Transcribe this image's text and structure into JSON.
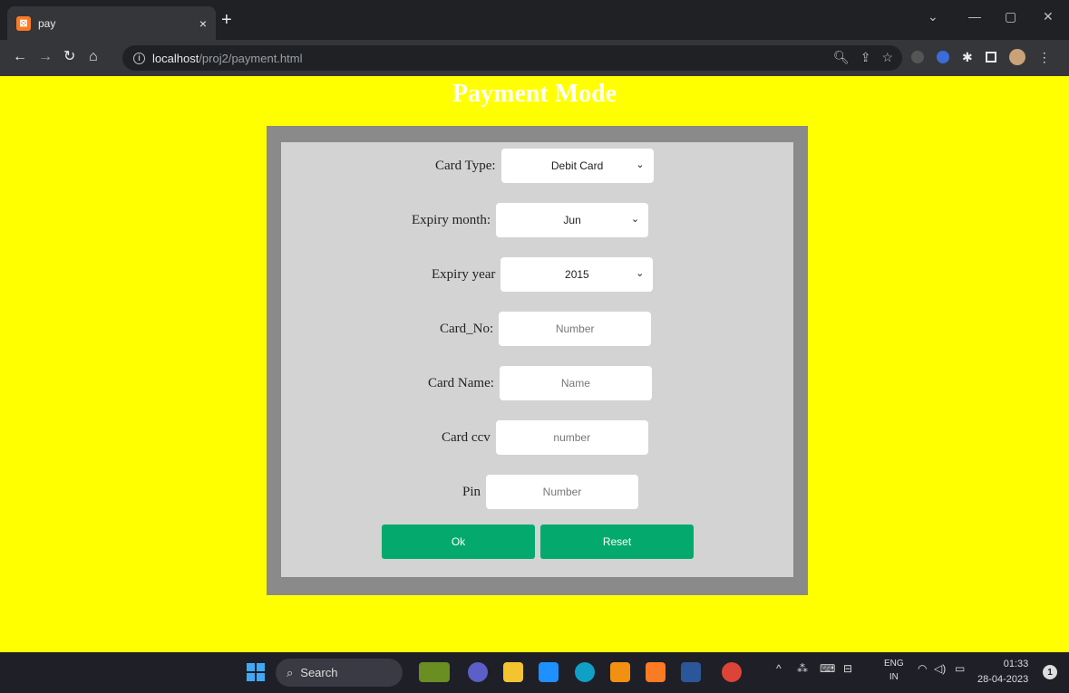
{
  "browser": {
    "tab_title": "pay",
    "tab_close": "×",
    "new_tab": "+",
    "url_host": "localhost",
    "url_path": "/proj2/payment.html"
  },
  "page": {
    "title": "Payment Mode",
    "form": {
      "card_type": {
        "label": "Card Type:",
        "value": "Debit Card"
      },
      "expiry_month": {
        "label": "Expiry month:",
        "value": "Jun"
      },
      "expiry_year": {
        "label": "Expiry year",
        "value": "2015"
      },
      "card_no": {
        "label": "Card_No:",
        "placeholder": "Number"
      },
      "card_name": {
        "label": "Card Name:",
        "placeholder": "Name"
      },
      "card_ccv": {
        "label": "Card ccv",
        "placeholder": "number"
      },
      "pin": {
        "label": "Pin",
        "placeholder": "Number"
      },
      "ok_label": "Ok",
      "reset_label": "Reset"
    }
  },
  "taskbar": {
    "search_label": "Search",
    "lang_top": "ENG",
    "lang_bottom": "IN",
    "time": "01:33",
    "date": "28-04-2023",
    "notification_count": "1"
  },
  "colors": {
    "page_background": "#ffff00",
    "button_green": "#04aa6d",
    "frame_outer": "#8a8a8a",
    "frame_inner": "#d3d3d3"
  }
}
